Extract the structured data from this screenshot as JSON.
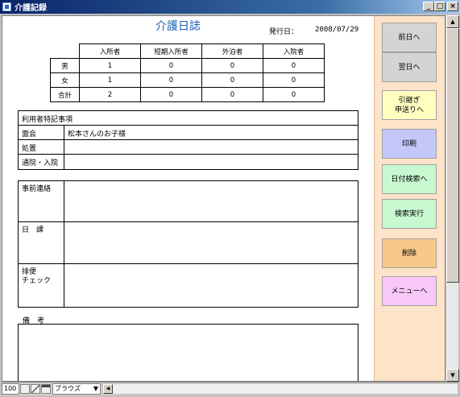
{
  "window": {
    "title": "介護記録",
    "minimize_glyph": "_",
    "maximize_glyph": "□",
    "close_glyph": "×"
  },
  "form": {
    "title": "介護日誌",
    "date_label": "発行日：",
    "date_value": "2008/07/29"
  },
  "stats": {
    "headers": [
      "入所者",
      "短期入所者",
      "外泊者",
      "入院者"
    ],
    "rows": [
      {
        "label": "男",
        "values": [
          "1",
          "0",
          "0",
          "0"
        ]
      },
      {
        "label": "女",
        "values": [
          "1",
          "0",
          "0",
          "0"
        ]
      },
      {
        "label": "合計",
        "values": [
          "2",
          "0",
          "0",
          "0"
        ]
      }
    ]
  },
  "notes": {
    "header": "利用者特記事項",
    "rows": [
      {
        "label": "面会",
        "value": "松本さんのお子様"
      },
      {
        "label": "処置",
        "value": ""
      },
      {
        "label": "通院・入院",
        "value": ""
      }
    ]
  },
  "blocks": [
    {
      "label": "事前連絡",
      "value": ""
    },
    {
      "label": "日　課",
      "value": ""
    },
    {
      "label": "排便\nチェック",
      "value": ""
    }
  ],
  "remarks": {
    "label": "備　考"
  },
  "sidebar": {
    "prev_day": "前日へ",
    "next_day": "翌日へ",
    "handover": "引継ぎ\n申送りへ",
    "print": "印刷",
    "date_search": "日付検索へ",
    "run_search": "検索実行",
    "delete": "削除",
    "menu": "メニューへ"
  },
  "statusbar": {
    "zoom": "100",
    "mode": "ブラウズ",
    "mode_arrow": "▼"
  },
  "scroll": {
    "up": "▲",
    "down": "▼",
    "left": "◀"
  }
}
